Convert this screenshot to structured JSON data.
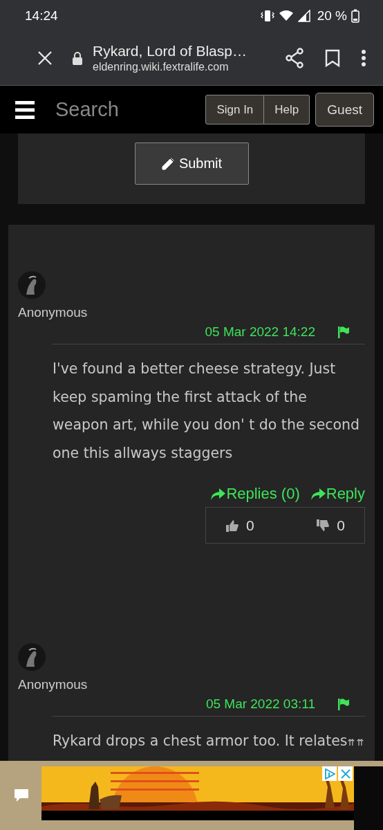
{
  "status_bar": {
    "time": "14:24",
    "battery": "20 %"
  },
  "browser": {
    "title": "Rykard, Lord of Blasp…",
    "url": "eldenring.wiki.fextralife.com"
  },
  "site_nav": {
    "search": {
      "placeholder": "Search"
    },
    "buttons": [
      "Sign In",
      "Help"
    ],
    "account": "Guest"
  },
  "submit_button": "Submit",
  "comments": [
    {
      "author": "Anonymous",
      "date": "05 Mar 2022 14:22",
      "text": "I've found a better cheese strategy. Just keep spaming the first attack of the weapon art, while you don' t do the second one this allways staggers",
      "replies": "Replies (0)",
      "reply": "Reply",
      "likes": "0",
      "dislikes": "0"
    },
    {
      "author": "Anonymous",
      "date": "05 Mar 2022 03:11",
      "text": "Rykard drops a chest armor too. It relates",
      "trailing": "⇈ ⇈"
    }
  ]
}
